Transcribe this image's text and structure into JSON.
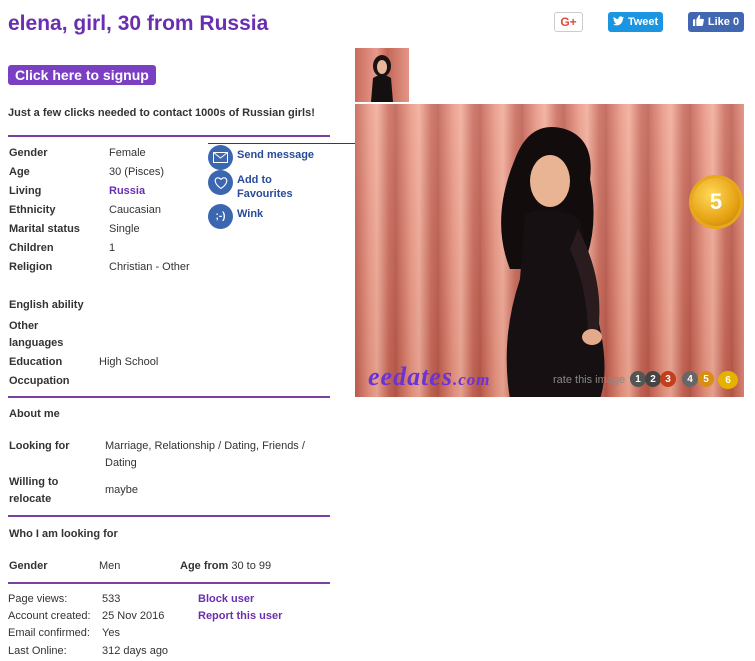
{
  "page": {
    "title": "elena, girl, 30 from Russia"
  },
  "social": {
    "gplus": "G+",
    "tweet": "Tweet",
    "like": "Like 0"
  },
  "signup": {
    "label": "Click here to signup"
  },
  "tagline": "Just a few clicks needed to contact 1000s of Russian girls!",
  "profile": {
    "gender_label": "Gender",
    "gender": "Female",
    "age_label": "Age",
    "age": "30 (Pisces)",
    "living_label": "Living",
    "living": "Russia",
    "ethnicity_label": "Ethnicity",
    "ethnicity": "Caucasian",
    "marital_label": "Marital status",
    "marital": "Single",
    "children_label": "Children",
    "children": "1",
    "religion_label": "Religion",
    "religion": "Christian - Other",
    "english_label": "English ability",
    "other_lang_label_1": "Other",
    "other_lang_label_2": "languages",
    "education_label": "Education",
    "education": "High School",
    "occupation_label": "Occupation"
  },
  "actions": {
    "send": "Send message",
    "fav_1": "Add to",
    "fav_2": "Favourites",
    "wink": "Wink"
  },
  "about": {
    "heading": "About me",
    "looking_label": "Looking for",
    "looking_1": "Marriage, Relationship / Dating, Friends /",
    "looking_2": "Dating",
    "relocate_label_1": "Willing to",
    "relocate_label_2": "relocate",
    "relocate": "maybe"
  },
  "seeking": {
    "heading": "Who I am looking for",
    "gender_label": "Gender",
    "gender": "Men",
    "age_label": "Age from",
    "age_from": "30",
    "age_to_word": "to",
    "age_to": "99"
  },
  "stats": {
    "views_label": "Page views:",
    "views": "533",
    "created_label": "Account created:",
    "created": "25 Nov 2016",
    "email_label": "Email confirmed:",
    "email": "Yes",
    "online_label": "Last Online:",
    "online": "312 days ago"
  },
  "links": {
    "block": "Block user",
    "report": "Report this user"
  },
  "photo": {
    "badge": "5",
    "watermark_main": "eedates",
    "watermark_dom": ".com",
    "rate_text": "rate this image",
    "rating_numbers": [
      "1",
      "2",
      "3",
      "4",
      "5",
      "6"
    ]
  },
  "colors": {
    "accent": "#6a2fb0",
    "action_blue": "#274b9a"
  }
}
